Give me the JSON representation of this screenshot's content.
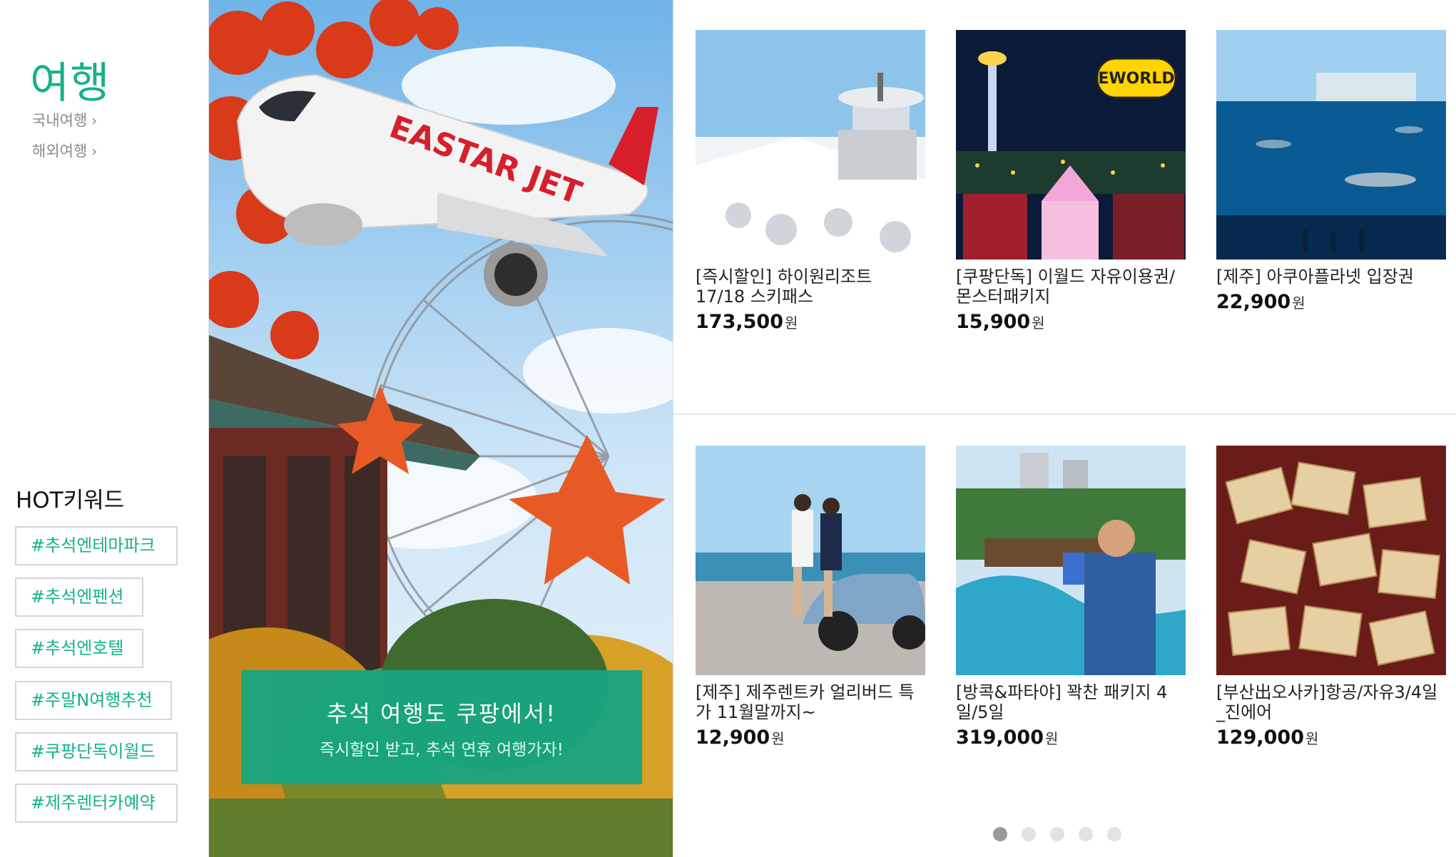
{
  "sidebar": {
    "title": "여행",
    "links": [
      {
        "label": "국내여행"
      },
      {
        "label": "해외여행"
      }
    ],
    "hot_title": "HOT키워드",
    "keywords": [
      "#추석엔테마파크",
      "#추석엔펜션",
      "#추석엔호텔",
      "#주말N여행추천",
      "#쿠팡단독이월드",
      "#제주렌터카예약"
    ]
  },
  "banner": {
    "title": "추석 여행도 쿠팡에서!",
    "subtitle": "즉시할인 받고, 추석 연휴 여행가자!",
    "image_logo_text": "EASTAR JET"
  },
  "products": [
    {
      "title": "[즉시할인] 하이원리조트 17/18 스키패스",
      "price": "173,500",
      "unit": "원"
    },
    {
      "title": "[쿠팡단독] 이월드 자유이용권/몬스터패키지",
      "price": "15,900",
      "unit": "원",
      "image_logo_text": "EWORLD"
    },
    {
      "title": "[제주] 아쿠아플라넷 입장권",
      "price": "22,900",
      "unit": "원"
    },
    {
      "title": "[제주] 제주렌트카 얼리버드 특가 11월말까지~",
      "price": "12,900",
      "unit": "원"
    },
    {
      "title": "[방콕&파타야] 꽉찬 패키지 4일/5일",
      "price": "319,000",
      "unit": "원"
    },
    {
      "title": "[부산出오사카]항공/자유3/4일_진에어",
      "price": "129,000",
      "unit": "원"
    }
  ],
  "pagination": {
    "count": 5,
    "active_index": 0
  },
  "colors": {
    "accent": "#14b18a",
    "banner_box": "#18a57f"
  }
}
